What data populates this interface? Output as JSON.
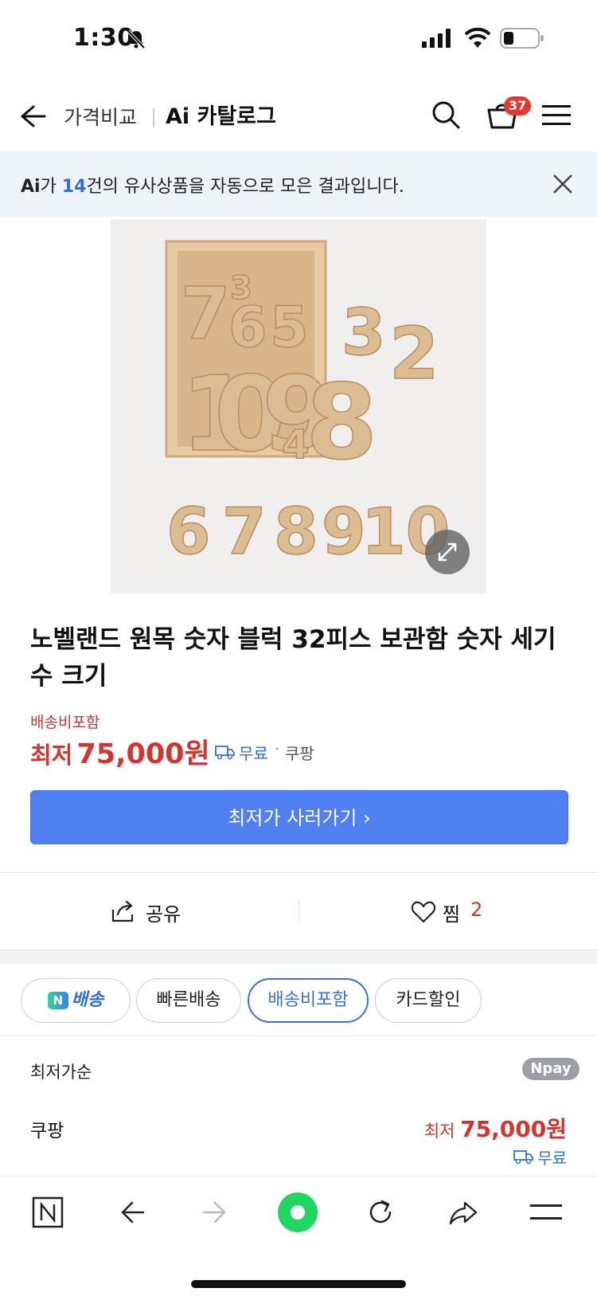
{
  "status": {
    "time": "1:30"
  },
  "header": {
    "crumb": "가격비교",
    "title": "Ai 카탈로그",
    "cart_count": "37"
  },
  "banner": {
    "prefix_ai": "Ai",
    "prefix_ga": "가 ",
    "count": "14",
    "suffix": "건의 유사상품을 자동으로 모은 결과입니다."
  },
  "product": {
    "title": "노벨랜드 원목 숫자 블럭 32피스 보관함 숫자 세기 수 크기",
    "shipping_included": "배송비포함",
    "price_label": "최저",
    "price": "75,000원",
    "free_shipping": "무료",
    "seller": "쿠팡",
    "image_digits": [
      "7",
      "3",
      "6",
      "5",
      "1",
      "0",
      "9",
      "8",
      "4",
      "3",
      "2",
      "6",
      "7",
      "8",
      "9",
      "10"
    ]
  },
  "cta": {
    "label": "최저가 사러가기 ›"
  },
  "actions": {
    "share": "공유",
    "zzim": "찜",
    "zzim_count": "2"
  },
  "filters": [
    {
      "label": "배송",
      "badge": "N",
      "active": false
    },
    {
      "label": "빠른배송",
      "active": false
    },
    {
      "label": "배송비포함",
      "active": true
    },
    {
      "label": "카드할인",
      "active": false
    }
  ],
  "list": {
    "sort": "최저가순",
    "npay": "Npay",
    "rows": [
      {
        "seller": "쿠팡",
        "price_label": "최저",
        "price": "75,000원",
        "shipping": "무료"
      }
    ]
  },
  "colors": {
    "accent": "#4f7ff0",
    "price": "#d6332e",
    "link": "#2f6fe0"
  }
}
